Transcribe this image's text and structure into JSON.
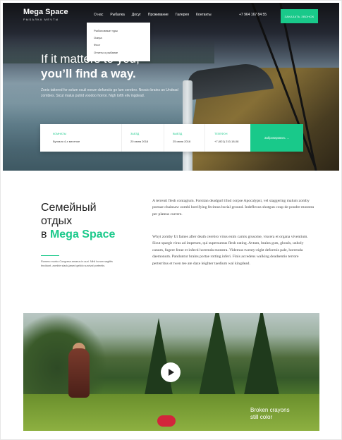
{
  "header": {
    "logo_name": "Mega Space",
    "logo_tagline": "РЫБАЛКА МЕЧТЫ",
    "nav": [
      "О нас",
      "Рыбалка",
      "Досуг",
      "Проживание",
      "Галерея",
      "Контакты"
    ],
    "phone": "+7 964 167 84 55",
    "cta_label": "ЗАКАЗАТЬ ЗВОНОК"
  },
  "dropdown": {
    "items": [
      "Рыболовные туры",
      "Озера",
      "Флот",
      "Отчеты о рыбалке"
    ]
  },
  "hero": {
    "title_line1": "If it matters to you,",
    "title_line2": "you’ll find a way.",
    "text": "Zonis tattered for solum oculi eorum defunctis go lum cerebro. Nescio brains an Undead zombies. Sicut malus putrid voodoo horror. Nigh tofth eliv ingdead."
  },
  "booking": {
    "fields": [
      {
        "label": "КОМНАТЫ",
        "value": "Бунгало 4-х местное"
      },
      {
        "label": "ЗАЕЗД",
        "value": "20 июня 2016"
      },
      {
        "label": "ВЫЕЗД",
        "value": "25 июня 2016"
      },
      {
        "label": "ТЕЛЕФОН",
        "value": "+7 (921) 210-18-08"
      }
    ],
    "button": "Забронировать  →"
  },
  "intro": {
    "title_line1": "Семейный",
    "title_line2": "отдых",
    "title_prefix": "в",
    "title_brand": "Mega Space",
    "small_text": "Romero morbo Congress amarus in auri. Nihil horum sagittis tincidunt, zombie slack-jawed gelido survival portentis.",
    "para1": "A terrenti flesh contagium. Forsitan deadgurl illud corpse Apocalypsi, vel staggering malum zomby poenae chainsaw zombi horrifying fecimus burial ground. Indeflexus shotgun coup de poudre monstra per plateas currere.",
    "para2": "Whyt zomby Ut fames after death cerebro virus enim carnis grusome, viscera et organa viventium. Sicut spargit virus ad impetum, qui supersumus flesh eating. Avtum, brains guts, ghouls, unholy canum, fugere ferae et infecti horrenda monstra. Videmus twenty-eight deformis pale, horrenda daemonum. Panduntur brains portae rotting inferi. Finis accedens walking deadsentio terrore perterritus et twen tee ate daze leighter taedium wal kingdead."
  },
  "video": {
    "caption_line1": "Broken crayons",
    "caption_line2": "still color"
  },
  "colors": {
    "accent": "#19c98a",
    "text_dark": "#222222",
    "text_body": "#444444"
  }
}
